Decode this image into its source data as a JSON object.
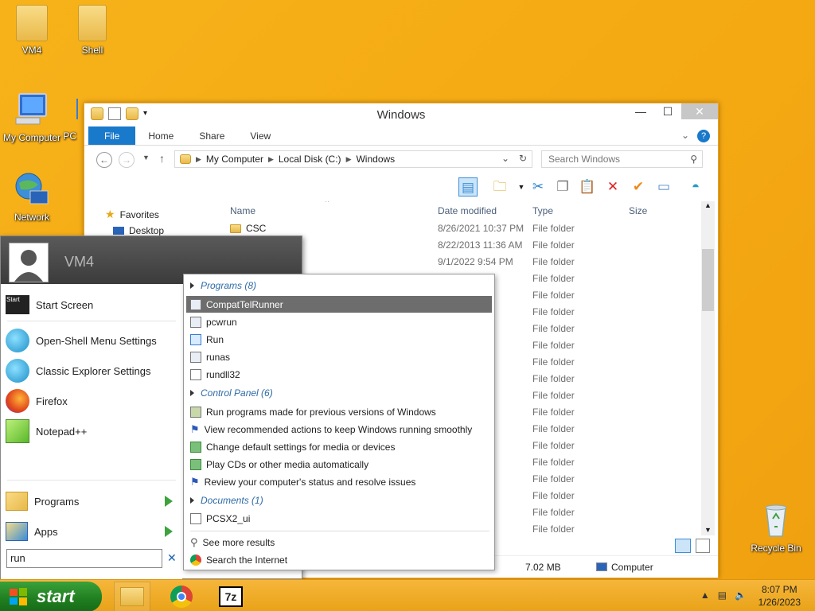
{
  "desktop": {
    "icons": [
      {
        "label": "VM4"
      },
      {
        "label": "Shell"
      },
      {
        "label": "My Computer"
      },
      {
        "label": "PC"
      },
      {
        "label": "Network"
      },
      {
        "label": "Recycle Bin"
      }
    ]
  },
  "explorer": {
    "title": "Windows",
    "tabs": {
      "file": "File",
      "home": "Home",
      "share": "Share",
      "view": "View"
    },
    "address": {
      "part1": "My Computer",
      "part2": "Local Disk (C:)",
      "part3": "Windows"
    },
    "search_placeholder": "Search Windows",
    "nav": {
      "favorites": "Favorites",
      "desktop": "Desktop"
    },
    "columns": {
      "name": "Name",
      "date": "Date modified",
      "type": "Type",
      "size": "Size"
    },
    "rows": [
      {
        "name": "CSC",
        "date": "8/26/2021 10:37 PM",
        "type": "File folder"
      },
      {
        "name": "",
        "date": "8/22/2013 11:36 AM",
        "type": "File folder"
      },
      {
        "name": "",
        "date": "9/1/2022 9:54 PM",
        "type": "File folder"
      },
      {
        "name": "",
        "date": "36 AM",
        "type": "File folder"
      },
      {
        "name": "",
        "date": "36 AM",
        "type": "File folder"
      },
      {
        "name": "",
        "date": "43 AM",
        "type": "File folder"
      },
      {
        "name": "",
        "date": "38 PM",
        "type": "File folder"
      },
      {
        "name": "",
        "date": "36 AM",
        "type": "File folder"
      },
      {
        "name": "",
        "date": ":16 ...",
        "type": "File folder"
      },
      {
        "name": "",
        "date": ":17 ...",
        "type": "File folder"
      },
      {
        "name": "",
        "date": "9 AM",
        "type": "File folder"
      },
      {
        "name": "",
        "date": "36 AM",
        "type": "File folder"
      },
      {
        "name": "",
        "date": "00 AM",
        "type": "File folder"
      },
      {
        "name": "",
        "date": ":17 ...",
        "type": "File folder"
      },
      {
        "name": "",
        "date": "9 AM",
        "type": "File folder"
      },
      {
        "name": "",
        "date": "8 PM",
        "type": "File folder"
      },
      {
        "name": "",
        "date": "36 AM",
        "type": "File folder"
      },
      {
        "name": "",
        "date": "36 AM",
        "type": "File folder"
      },
      {
        "name": "",
        "date": "36 AM",
        "type": "File folder"
      }
    ],
    "status": {
      "size": "7.02 MB",
      "location": "Computer"
    }
  },
  "start_menu": {
    "user": "VM4",
    "items": {
      "start_screen": "Start Screen",
      "openshell_settings": "Open-Shell Menu Settings",
      "classic_explorer": "Classic Explorer Settings",
      "firefox": "Firefox",
      "notepadpp": "Notepad++",
      "programs": "Programs",
      "apps": "Apps"
    },
    "search_value": "run",
    "search_clear": "✕",
    "start_tile_text": "Start"
  },
  "results": {
    "programs_header": "Programs (8)",
    "programs": [
      "CompatTelRunner",
      "pcwrun",
      "Run",
      "runas",
      "rundll32"
    ],
    "control_header": "Control Panel (6)",
    "control": [
      "Run programs made for previous versions of Windows",
      "View recommended actions to keep Windows running smoothly",
      "Change default settings for media or devices",
      "Play CDs or other media automatically",
      "Review your computer's status and resolve issues"
    ],
    "documents_header": "Documents (1)",
    "documents": [
      "PCSX2_ui"
    ],
    "see_more": "See more results",
    "search_internet": "Search the Internet"
  },
  "taskbar": {
    "start_label": "start",
    "app_7z": "7z",
    "time": "8:07 PM",
    "date": "1/26/2023"
  },
  "colors": {
    "desktop": "#f4a912",
    "accent": "#1979ca",
    "selection": "#6d6d6d",
    "start_green": "#2a8f2a"
  }
}
